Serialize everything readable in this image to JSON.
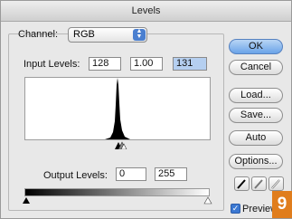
{
  "window": {
    "title": "Levels"
  },
  "channel": {
    "label": "Channel:",
    "value": "RGB"
  },
  "input_levels": {
    "label": "Input Levels:",
    "black": "128",
    "gamma": "1.00",
    "white": "131"
  },
  "output_levels": {
    "label": "Output Levels:",
    "black": "0",
    "white": "255"
  },
  "buttons": {
    "ok": "OK",
    "cancel": "Cancel",
    "load": "Load...",
    "save": "Save...",
    "auto": "Auto",
    "options": "Options..."
  },
  "preview": {
    "label": "Preview",
    "checked": true
  },
  "badge": {
    "text": "9",
    "color": "#e07d1c"
  },
  "accent_color": "#4a7fd0"
}
